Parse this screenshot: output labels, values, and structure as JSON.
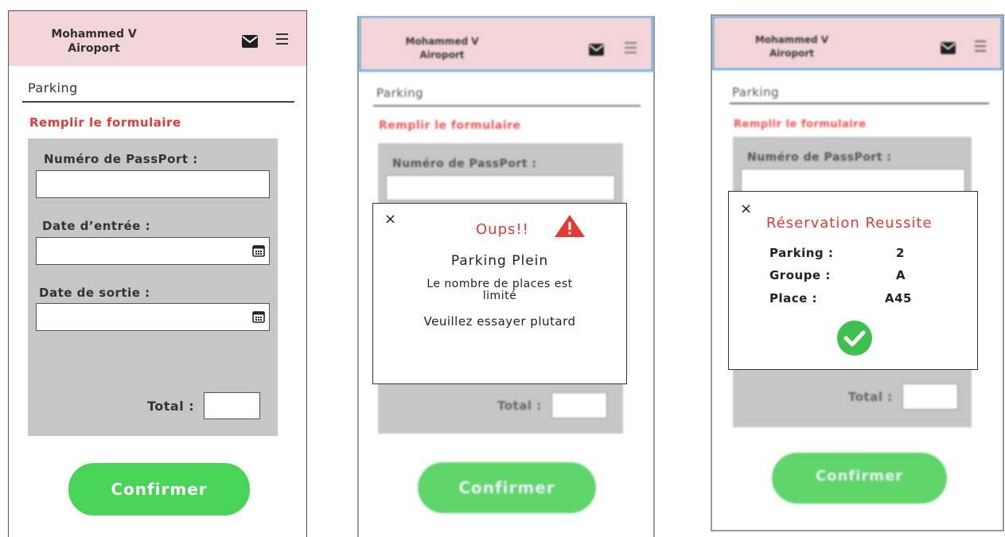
{
  "app": {
    "brand_line1": "Mohammed V",
    "brand_line2": "Airoport"
  },
  "icons": {
    "mail": "mail-icon",
    "menu": "hamburger-menu-icon",
    "calendar": "calendar-icon",
    "close": "close-icon",
    "warning": "warning-icon",
    "success": "check-circle-icon"
  },
  "colors": {
    "header_bg": "#f1d5d7",
    "accent_red": "#e53935",
    "panel_grey": "#c6c6c6",
    "confirm_green": "#48d456",
    "header_border_blue": "#3a9be0"
  },
  "page": {
    "section_title": "Parking",
    "form_subtitle": "Remplir le formulaire"
  },
  "form": {
    "passport_label": "Numéro de PassPort :",
    "entry_date_label": "Date d’entrée :",
    "exit_date_label": "Date de sortie :",
    "total_label": "Total :",
    "passport_value": "",
    "entry_date_value": "",
    "exit_date_value": "",
    "total_value": ""
  },
  "buttons": {
    "confirm": "Confirmer"
  },
  "error_modal": {
    "close": "×",
    "title": "Oups!!",
    "headline": "Parking Plein",
    "message_line1": "Le nombre de places est",
    "message_line2": "limité",
    "retry_message": "Veuillez essayer plutard"
  },
  "success_modal": {
    "close": "×",
    "title": "Réservation Reussite",
    "rows": [
      {
        "label": "Parking :",
        "value": "2"
      },
      {
        "label": "Groupe :",
        "value": "A"
      },
      {
        "label": "Place :",
        "value": "A45"
      }
    ]
  }
}
